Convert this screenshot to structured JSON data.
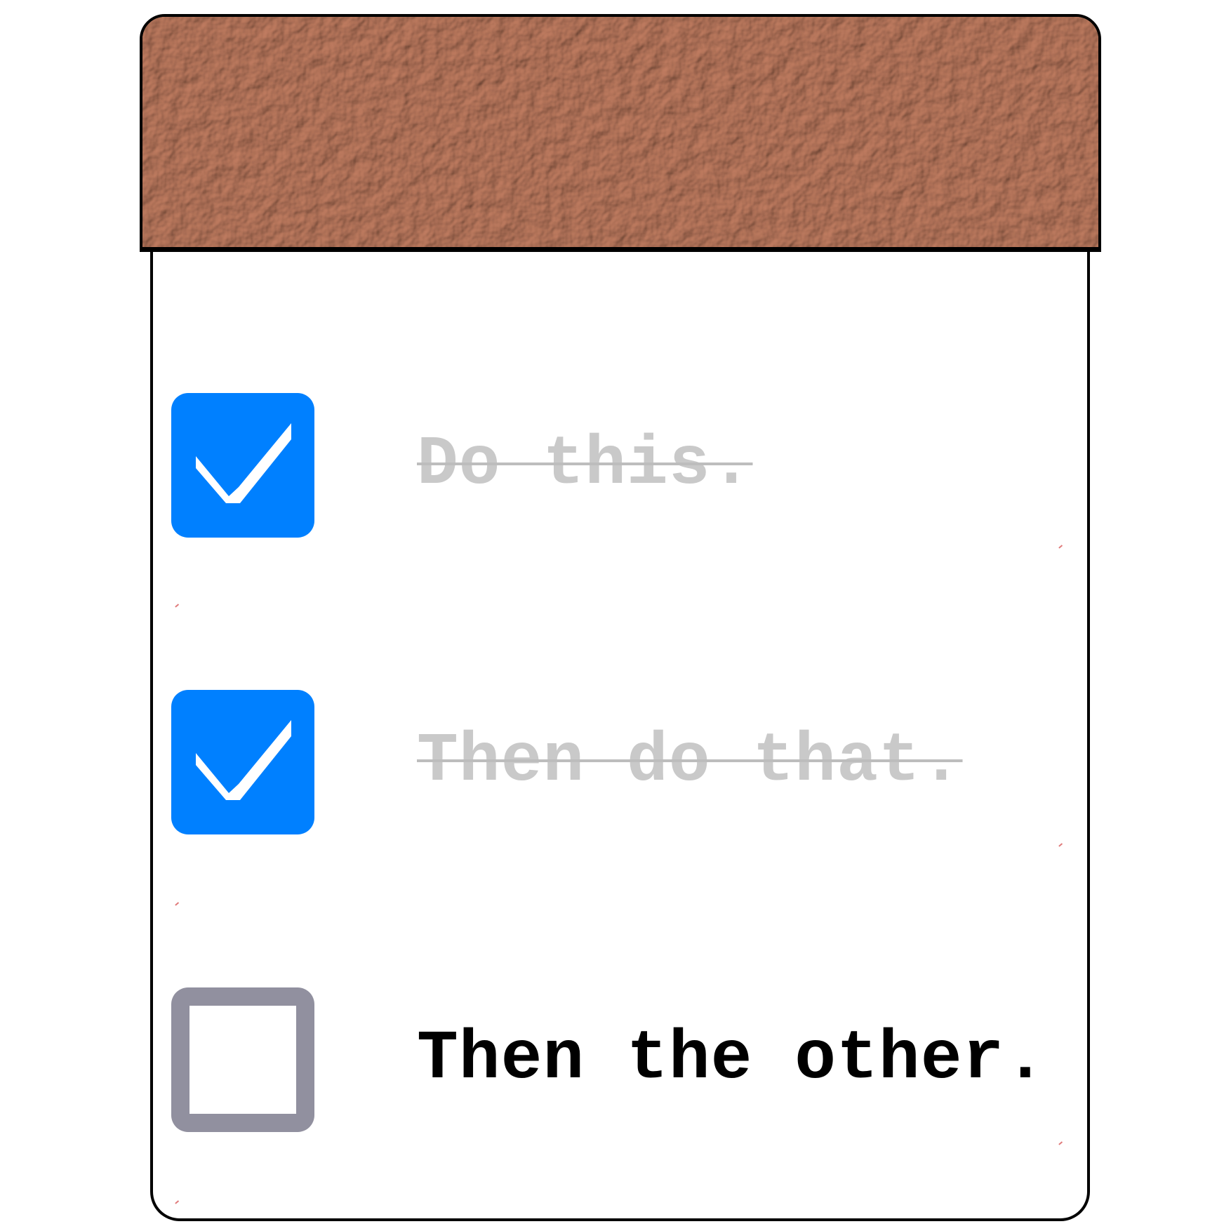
{
  "colors": {
    "header_leather": "#b7836a",
    "checked_fill": "#0080ff",
    "unchecked_border": "#91909f",
    "done_text": "#c9c9c9",
    "todo_text": "#000000",
    "outline": "#000000"
  },
  "icons": {
    "checked": "checkmark-icon",
    "unchecked": "empty-checkbox-icon"
  },
  "tasks": [
    {
      "label": "Do this.",
      "checked": true
    },
    {
      "label": "Then do that.",
      "checked": true
    },
    {
      "label": "Then the other.",
      "checked": false
    }
  ]
}
